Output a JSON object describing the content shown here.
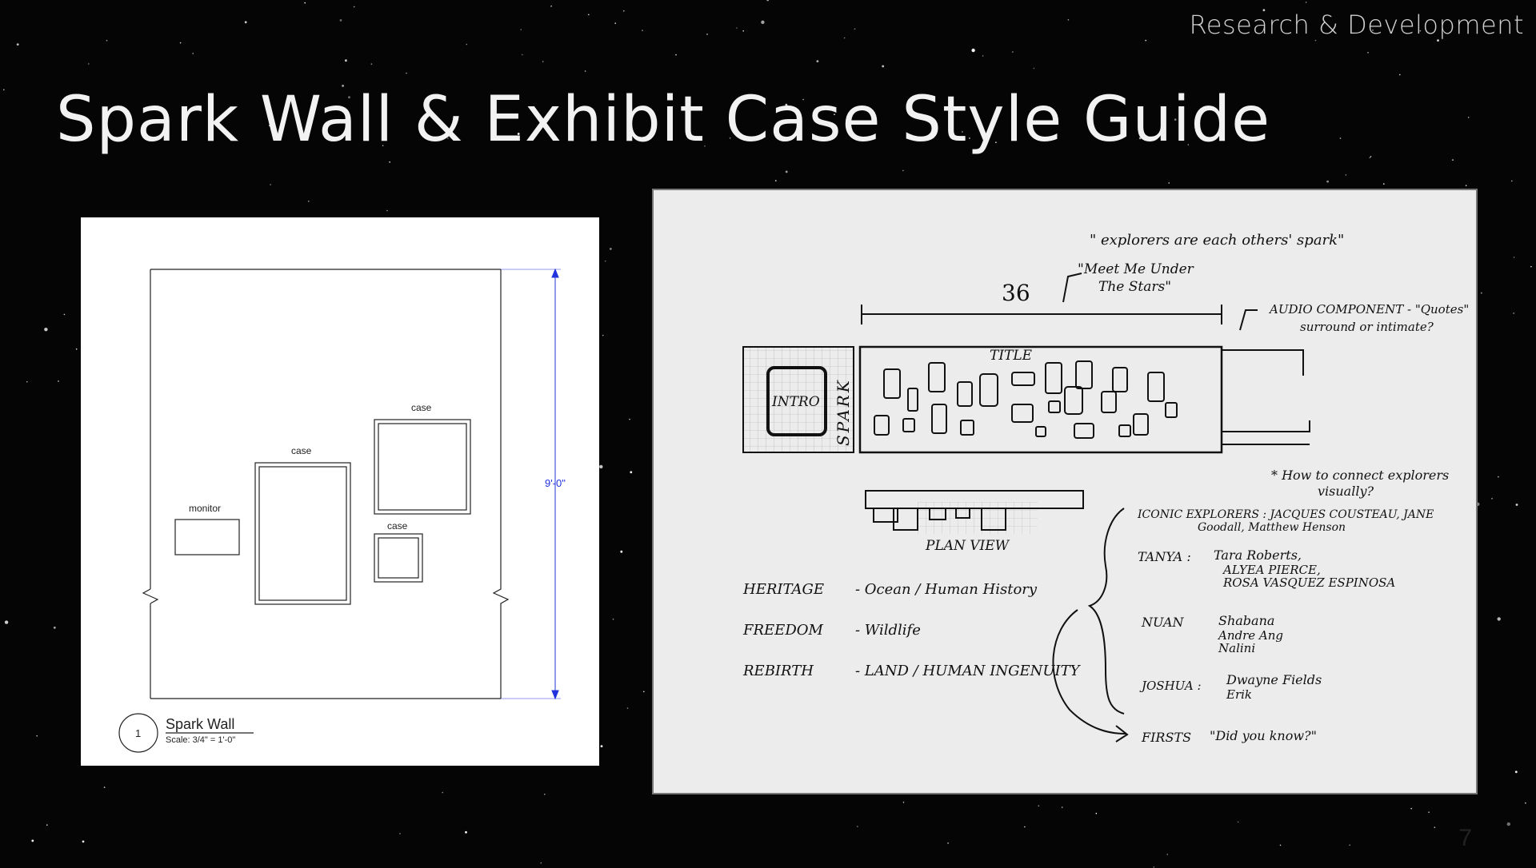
{
  "header": {
    "section": "Research & Development"
  },
  "slide": {
    "title": "Spark Wall & Exhibit Case Style Guide",
    "page_number": "7"
  },
  "drawing": {
    "labels": {
      "case_tall": "case",
      "case_top": "case",
      "case_small": "case",
      "monitor": "monitor"
    },
    "dimension": "9'-0\"",
    "legend": {
      "number": "1",
      "title": "Spark Wall",
      "scale": "Scale: 3/4\" = 1'-0\""
    }
  },
  "sketch": {
    "quote_1": "\" explorers are each others' spark\"",
    "quote_2a": "\"Meet Me Under",
    "quote_2b": "The Stars\"",
    "dimension": "36",
    "audio_a": "AUDIO COMPONENT - \"Quotes\"",
    "audio_b": "surround or intimate?",
    "title_label": "TITLE",
    "intro_label": "INTRO",
    "spark_label": "SPARK",
    "connect_a": "* How to connect explorers",
    "connect_b": "visually?",
    "plan_view": "PLAN VIEW",
    "themes": [
      {
        "name": "HERITAGE",
        "desc": "- Ocean / Human History"
      },
      {
        "name": "FREEDOM",
        "desc": "- Wildlife"
      },
      {
        "name": "REBIRTH",
        "desc": "- LAND / HUMAN INGENUITY"
      }
    ],
    "iconic_a": "ICONIC EXPLORERS : JACQUES COUSTEAU, JANE",
    "iconic_b": "Goodall, Matthew Henson",
    "tanya_label": "TANYA :",
    "tanya_a": "Tara Roberts,",
    "tanya_b": "ALYEA PIERCE,",
    "tanya_c": "ROSA VASQUEZ ESPINOSA",
    "nuan_label": "NUAN",
    "nuan_a": "Shabana",
    "nuan_b": "Andre Ang",
    "nuan_c": "Nalini",
    "joshua_label": "JOSHUA :",
    "joshua_a": "Dwayne Fields",
    "joshua_b": "Erik",
    "firsts_label": "FIRSTS",
    "firsts_q": "\"Did you know?\""
  }
}
